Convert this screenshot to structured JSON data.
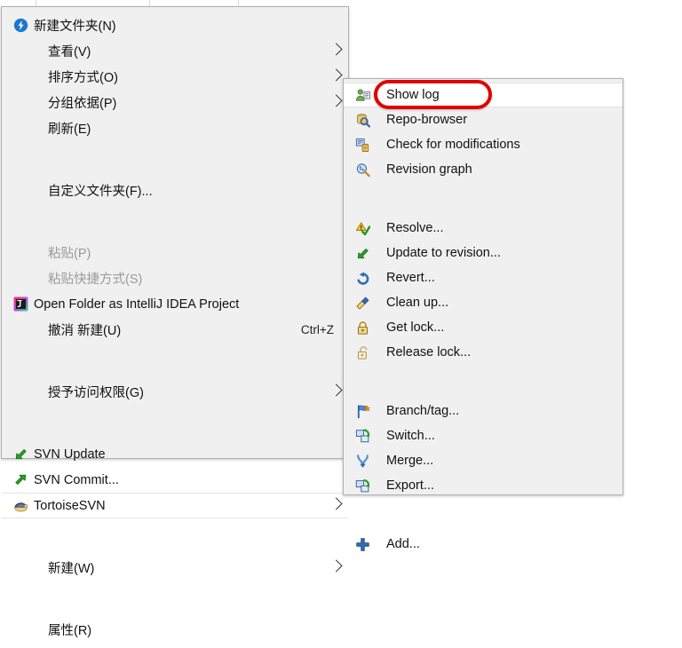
{
  "context_menu": {
    "name": "windows-folder-context-menu",
    "items": [
      {
        "label": "新建文件夹(N)",
        "icon": "blue-new-folder-icon",
        "type": "item",
        "icon_present": true
      },
      {
        "label": "查看(V)",
        "type": "submenu",
        "icon_present": false
      },
      {
        "label": "排序方式(O)",
        "type": "submenu",
        "icon_present": false
      },
      {
        "label": "分组依据(P)",
        "type": "submenu",
        "icon_present": false
      },
      {
        "label": "刷新(E)",
        "type": "item",
        "icon_present": false
      },
      {
        "type": "separator"
      },
      {
        "label": "自定义文件夹(F)...",
        "type": "item",
        "icon_present": false
      },
      {
        "type": "separator"
      },
      {
        "label": "粘贴(P)",
        "type": "item",
        "disabled": true,
        "icon_present": false
      },
      {
        "label": "粘贴快捷方式(S)",
        "type": "item",
        "disabled": true,
        "icon_present": false
      },
      {
        "label": "Open Folder as IntelliJ IDEA Project",
        "icon": "intellij-idea-icon",
        "type": "item",
        "icon_present": true
      },
      {
        "label": "撤消 新建(U)",
        "accel": "Ctrl+Z",
        "type": "item",
        "icon_present": false
      },
      {
        "type": "separator"
      },
      {
        "label": "授予访问权限(G)",
        "type": "submenu",
        "icon_present": false
      },
      {
        "type": "separator"
      },
      {
        "label": "SVN Update",
        "icon": "green-update-arrow-icon",
        "type": "item",
        "icon_present": true
      },
      {
        "label": "SVN Commit...",
        "icon": "green-commit-arrow-icon",
        "type": "item",
        "icon_present": true
      },
      {
        "label": "TortoiseSVN",
        "icon": "tortoise-icon",
        "type": "submenu",
        "icon_present": true,
        "highlighted": true
      },
      {
        "type": "separator"
      },
      {
        "label": "新建(W)",
        "type": "submenu",
        "icon_present": false
      },
      {
        "type": "separator"
      },
      {
        "label": "属性(R)",
        "type": "item",
        "icon_present": false
      }
    ]
  },
  "submenu": {
    "name": "tortoisesvn-submenu",
    "items": [
      {
        "label": "Show log",
        "icon": "show-log-icon",
        "highlighted": true,
        "annotated": true
      },
      {
        "label": "Repo-browser",
        "icon": "repo-browser-icon"
      },
      {
        "label": "Check for modifications",
        "icon": "check-modifications-icon"
      },
      {
        "label": "Revision graph",
        "icon": "revision-graph-icon"
      },
      {
        "type": "separator"
      },
      {
        "label": "Resolve...",
        "icon": "resolve-icon"
      },
      {
        "label": "Update to revision...",
        "icon": "update-to-revision-icon"
      },
      {
        "label": "Revert...",
        "icon": "revert-icon"
      },
      {
        "label": "Clean up...",
        "icon": "clean-up-icon"
      },
      {
        "label": "Get lock...",
        "icon": "lock-closed-icon"
      },
      {
        "label": "Release lock...",
        "icon": "lock-open-icon"
      },
      {
        "type": "separator"
      },
      {
        "label": "Branch/tag...",
        "icon": "branch-tag-icon"
      },
      {
        "label": "Switch...",
        "icon": "switch-icon"
      },
      {
        "label": "Merge...",
        "icon": "merge-icon"
      },
      {
        "label": "Export...",
        "icon": "export-icon"
      },
      {
        "type": "separator"
      },
      {
        "label": "Add...",
        "icon": "add-icon"
      }
    ]
  },
  "annotation": {
    "name": "red-highlight-oval",
    "target": "Show log",
    "color": "#e00000"
  },
  "colors": {
    "menu_background": "#f0f0f0",
    "menu_border": "#b0b0b0",
    "highlight_background": "#ffffff",
    "separator": "#d7d7d7",
    "text": "#111111",
    "disabled_text": "#9a9a9a",
    "annotation_red": "#e00000"
  }
}
